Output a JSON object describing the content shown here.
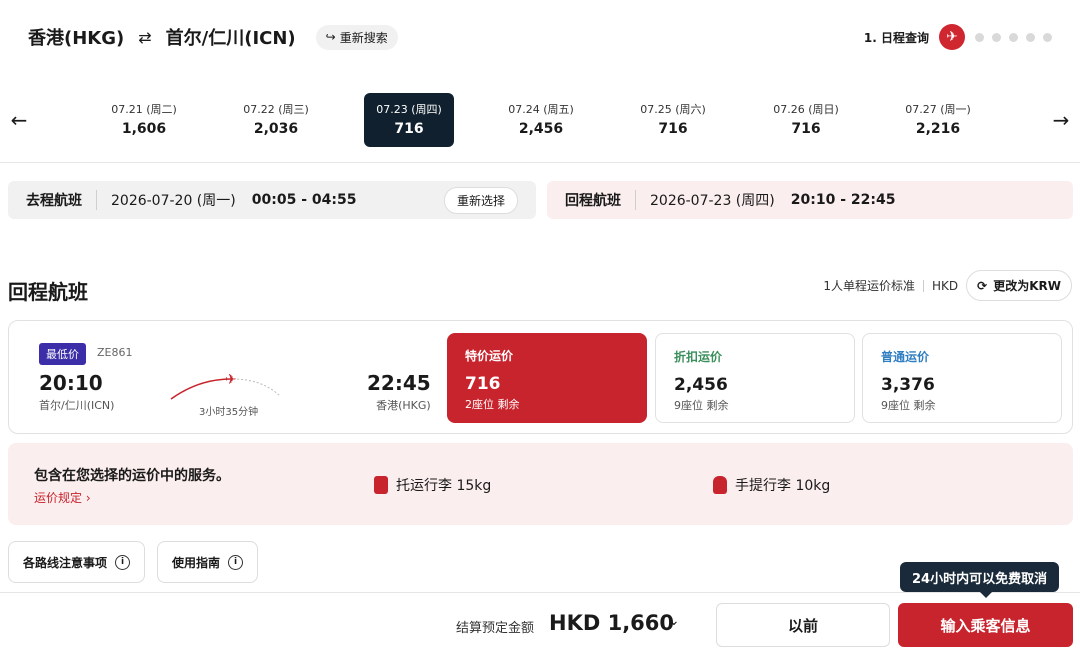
{
  "header": {
    "origin": "香港(HKG)",
    "swap_icon": "⇄",
    "destination": "首尔/仁川(ICN)",
    "research_label": "重新搜索",
    "step_label": "1. 日程查询"
  },
  "dates": [
    {
      "date": "07.21 (周二)",
      "price": "1,606"
    },
    {
      "date": "07.22 (周三)",
      "price": "2,036"
    },
    {
      "date": "07.23 (周四)",
      "price": "716"
    },
    {
      "date": "07.24 (周五)",
      "price": "2,456"
    },
    {
      "date": "07.25 (周六)",
      "price": "716"
    },
    {
      "date": "07.26 (周日)",
      "price": "716"
    },
    {
      "date": "07.27 (周一)",
      "price": "2,216"
    }
  ],
  "outbound": {
    "label": "去程航班",
    "date": "2026-07-20 (周一)",
    "time": "00:05 - 04:55",
    "reselect": "重新选择"
  },
  "return_summary": {
    "label": "回程航班",
    "date": "2026-07-23 (周四)",
    "time": "20:10 - 22:45"
  },
  "section": {
    "title": "回程航班",
    "fare_note": "1人单程运价标准",
    "currency": "HKD",
    "krw_button": "更改为KRW"
  },
  "flight": {
    "badge": "最低价",
    "number": "ZE861",
    "dep_time": "20:10",
    "dep_airport": "首尔/仁川(ICN)",
    "duration": "3小时35分钟",
    "arr_time": "22:45",
    "arr_airport": "香港(HKG)",
    "fares": [
      {
        "name": "特价运价",
        "price": "716",
        "seats": "2座位 剩余"
      },
      {
        "name": "折扣运价",
        "price": "2,456",
        "seats": "9座位 剩余"
      },
      {
        "name": "普通运价",
        "price": "3,376",
        "seats": "9座位 剩余"
      }
    ]
  },
  "services": {
    "heading": "包含在您选择的运价中的服务。",
    "rule_link": "运价规定",
    "checked": "托运行李 15kg",
    "carry": "手提行李 10kg"
  },
  "info_buttons": {
    "notes": "各路线注意事项",
    "guide": "使用指南"
  },
  "footer": {
    "total_label": "结算预定金额",
    "total_value": "HKD 1,660",
    "prev": "以前",
    "next": "输入乘客信息",
    "tooltip": "24小时内可以免费取消"
  },
  "colors": {
    "accent": "#c8242d",
    "selected_date": "#10202e",
    "badge": "#3b2ea8"
  }
}
